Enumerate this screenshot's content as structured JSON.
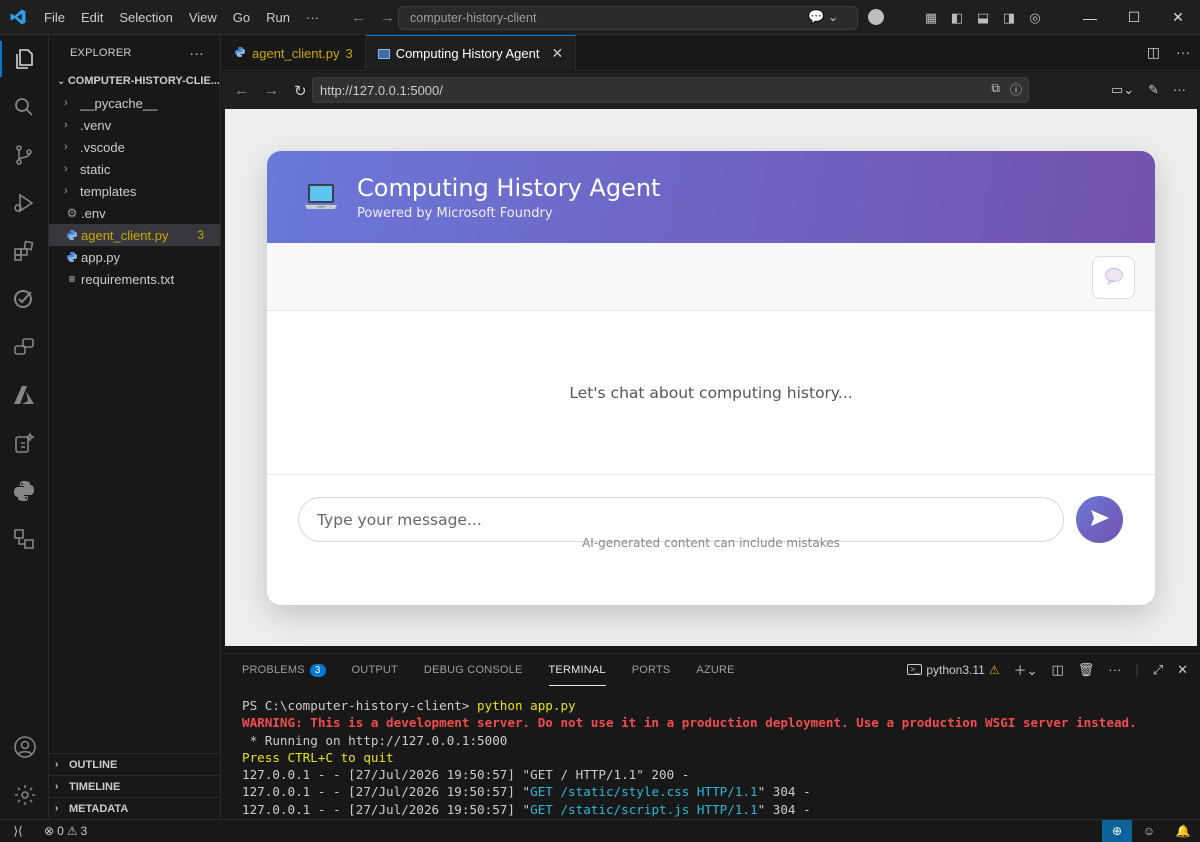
{
  "menu": [
    "File",
    "Edit",
    "Selection",
    "View",
    "Go",
    "Run",
    "···"
  ],
  "command_center": {
    "text": "computer-history-client"
  },
  "explorer": {
    "header": "EXPLORER",
    "root": "COMPUTER-HISTORY-CLIE...",
    "items": [
      {
        "label": "__pycache__"
      },
      {
        "label": ".venv"
      },
      {
        "label": ".vscode"
      },
      {
        "label": "static"
      },
      {
        "label": "templates"
      },
      {
        "label": ".env"
      },
      {
        "label": "agent_client.py",
        "badge": "3"
      },
      {
        "label": "app.py"
      },
      {
        "label": "requirements.txt"
      }
    ],
    "sections": [
      "OUTLINE",
      "TIMELINE",
      "METADATA"
    ]
  },
  "tabs": [
    {
      "label": "agent_client.py",
      "badge": "3"
    },
    {
      "label": "Computing History Agent"
    }
  ],
  "browser": {
    "url": "http://127.0.0.1:5000/"
  },
  "app": {
    "title": "Computing History Agent",
    "subtitle": "Powered by Microsoft Foundry",
    "welcome": "Let's chat about computing history...",
    "input_placeholder": "Type your message...",
    "disclaimer": "AI-generated content can include mistakes",
    "accent_start": "#6a78d9",
    "accent_end": "#7452ad"
  },
  "panel": {
    "tabs": [
      {
        "label": "PROBLEMS",
        "badge": "3"
      },
      {
        "label": "OUTPUT"
      },
      {
        "label": "DEBUG CONSOLE"
      },
      {
        "label": "TERMINAL"
      },
      {
        "label": "PORTS"
      },
      {
        "label": "AZURE"
      }
    ],
    "shell": "python3.11",
    "terminal": {
      "prompt": "PS C:\\computer-history-client> ",
      "command": "python app.py",
      "warning": "WARNING: This is a development server. Do not use it in a production deployment. Use a production WSGI server instead.",
      "running": " * Running on http://127.0.0.1:5000",
      "quit": "Press CTRL+C to quit",
      "log1": "127.0.0.1 - - [27/Jul/2026 19:50:57] \"GET / HTTP/1.1\" 200 -",
      "log2_pre": "127.0.0.1 - - [27/Jul/2026 19:50:57] \"",
      "log2_req": "GET /static/style.css HTTP/1.1",
      "log2_post": "\" 304 -",
      "log3_pre": "127.0.0.1 - - [27/Jul/2026 19:50:57] \"",
      "log3_req": "GET /static/script.js HTTP/1.1",
      "log3_post": "\" 304 -"
    }
  },
  "status": {
    "errors": "0",
    "warnings": "3"
  }
}
